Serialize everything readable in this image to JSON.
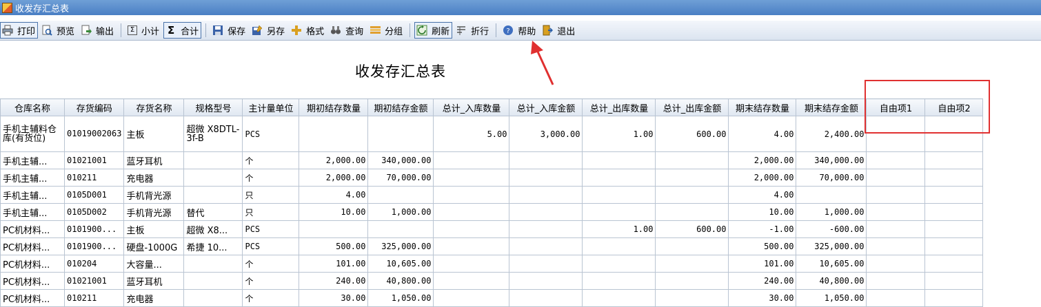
{
  "window": {
    "title": "收发存汇总表"
  },
  "toolbar": {
    "print": "打印",
    "preview": "预览",
    "export": "输出",
    "subtotal": "小计",
    "total": "合计",
    "save": "保存",
    "save_as": "另存",
    "format": "格式",
    "query": "查询",
    "group": "分组",
    "refresh": "刷新",
    "wrap": "折行",
    "help": "帮助",
    "exit": "退出"
  },
  "report": {
    "title": "收发存汇总表"
  },
  "table": {
    "headers": [
      "仓库名称",
      "存货编码",
      "存货名称",
      "规格型号",
      "主计量单位",
      "期初结存数量",
      "期初结存金额",
      "总计_入库数量",
      "总计_入库金额",
      "总计_出库数量",
      "总计_出库金额",
      "期末结存数量",
      "期末结存金额",
      "自由项1",
      "自由项2"
    ],
    "rows": [
      [
        "手机主辅料仓库(有货位)",
        "01019002063",
        "主板",
        "超微 X8DTL-3f-B",
        "PCS",
        "",
        "",
        "5.00",
        "3,000.00",
        "1.00",
        "600.00",
        "4.00",
        "2,400.00",
        "",
        ""
      ],
      [
        "手机主辅...",
        "01021001",
        "蓝牙耳机",
        "",
        "个",
        "2,000.00",
        "340,000.00",
        "",
        "",
        "",
        "",
        "2,000.00",
        "340,000.00",
        "",
        ""
      ],
      [
        "手机主辅...",
        "010211",
        "充电器",
        "",
        "个",
        "2,000.00",
        "70,000.00",
        "",
        "",
        "",
        "",
        "2,000.00",
        "70,000.00",
        "",
        ""
      ],
      [
        "手机主辅...",
        "0105D001",
        "手机背光源",
        "",
        "只",
        "4.00",
        "",
        "",
        "",
        "",
        "",
        "4.00",
        "",
        "",
        ""
      ],
      [
        "手机主辅...",
        "0105D002",
        "手机背光源",
        "替代",
        "只",
        "10.00",
        "1,000.00",
        "",
        "",
        "",
        "",
        "10.00",
        "1,000.00",
        "",
        ""
      ],
      [
        "PC机材料...",
        "0101900...",
        "主板",
        "超微 X8...",
        "PCS",
        "",
        "",
        "",
        "",
        "1.00",
        "600.00",
        "-1.00",
        "-600.00",
        "",
        ""
      ],
      [
        "PC机材料...",
        "0101900...",
        "硬盘-1000G",
        "希捷 10...",
        "PCS",
        "500.00",
        "325,000.00",
        "",
        "",
        "",
        "",
        "500.00",
        "325,000.00",
        "",
        ""
      ],
      [
        "PC机材料...",
        "010204",
        "大容量...",
        "",
        "个",
        "101.00",
        "10,605.00",
        "",
        "",
        "",
        "",
        "101.00",
        "10,605.00",
        "",
        ""
      ],
      [
        "PC机材料...",
        "01021001",
        "蓝牙耳机",
        "",
        "个",
        "240.00",
        "40,800.00",
        "",
        "",
        "",
        "",
        "240.00",
        "40,800.00",
        "",
        ""
      ],
      [
        "PC机材料...",
        "010211",
        "充电器",
        "",
        "个",
        "30.00",
        "1,050.00",
        "",
        "",
        "",
        "",
        "30.00",
        "1,050.00",
        "",
        ""
      ]
    ]
  }
}
